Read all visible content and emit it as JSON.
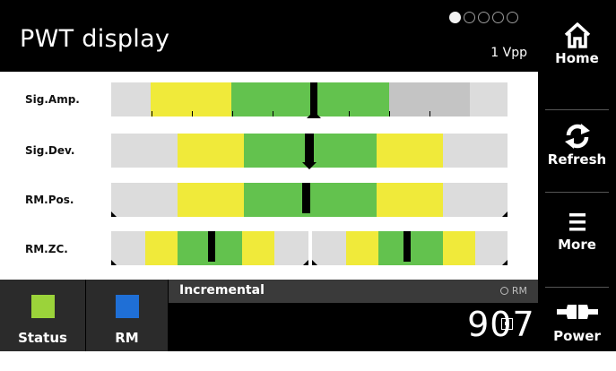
{
  "header": {
    "title": "PWT display",
    "unit": "1 Vpp",
    "page_dots": {
      "count": 5,
      "active_index": 0
    }
  },
  "rows": [
    {
      "label": "Sig.Amp."
    },
    {
      "label": "Sig.Dev."
    },
    {
      "label": "RM.Pos."
    },
    {
      "label": "RM.ZC."
    }
  ],
  "nav": {
    "home": "Home",
    "refresh": "Refresh",
    "more": "More",
    "power": "Power"
  },
  "bottom": {
    "status_label": "Status",
    "rm_label": "RM",
    "mode_label": "Incremental",
    "rm_indicator": "RM",
    "value": "90714"
  },
  "colors": {
    "status_indicator": "#9bd33a",
    "rm_indicator": "#1f6fd6",
    "zone_yellow": "#f0ea3a",
    "zone_green": "#63c24e",
    "zone_gray": "#dcdcdc"
  }
}
